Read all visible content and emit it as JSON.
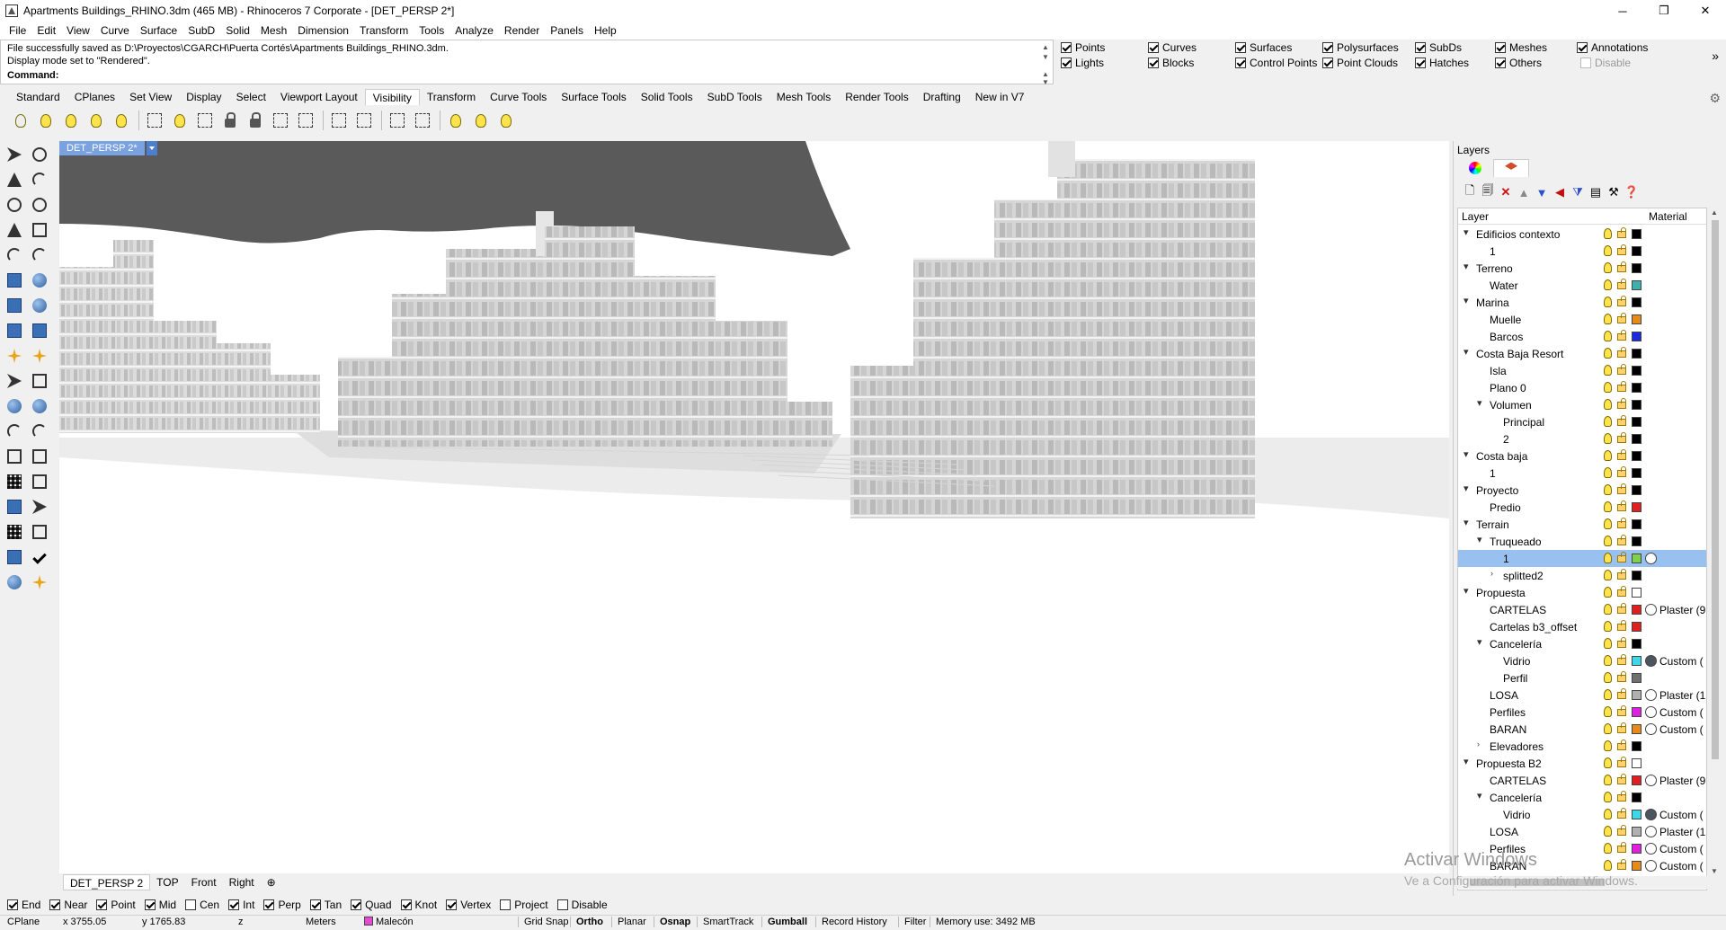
{
  "window": {
    "title": "Apartments Buildings_RHINO.3dm (465 MB) - Rhinoceros 7 Corporate - [DET_PERSP 2*]",
    "minimize": "─",
    "maximize": "❐",
    "close": "✕"
  },
  "menu": [
    "File",
    "Edit",
    "View",
    "Curve",
    "Surface",
    "SubD",
    "Solid",
    "Mesh",
    "Dimension",
    "Transform",
    "Tools",
    "Analyze",
    "Render",
    "Panels",
    "Help"
  ],
  "command": {
    "history_1": "File successfully saved as D:\\Proyectos\\CGARCH\\Puerta Cortés\\Apartments Buildings_RHINO.3dm.",
    "history_2": "Display mode set to \"Rendered\".",
    "prompt_label": "Command:",
    "input_value": ""
  },
  "selection_filters": [
    {
      "label": "Points",
      "checked": true
    },
    {
      "label": "Curves",
      "checked": true
    },
    {
      "label": "Surfaces",
      "checked": true
    },
    {
      "label": "Polysurfaces",
      "checked": true
    },
    {
      "label": "SubDs",
      "checked": true
    },
    {
      "label": "Meshes",
      "checked": true
    },
    {
      "label": "Annotations",
      "checked": true
    },
    {
      "label": "Lights",
      "checked": true
    },
    {
      "label": "Blocks",
      "checked": true
    },
    {
      "label": "Control Points",
      "checked": true
    },
    {
      "label": "Point Clouds",
      "checked": true
    },
    {
      "label": "Hatches",
      "checked": true
    },
    {
      "label": "Others",
      "checked": true
    },
    {
      "label": "Disable",
      "checked": false
    }
  ],
  "filters_more": "»",
  "toolbar_tabs": [
    "Standard",
    "CPlanes",
    "Set View",
    "Display",
    "Select",
    "Viewport Layout",
    "Visibility",
    "Transform",
    "Curve Tools",
    "Surface Tools",
    "Solid Tools",
    "SubD Tools",
    "Mesh Tools",
    "Render Tools",
    "Drafting",
    "New in V7"
  ],
  "active_toolbar_tab": "Visibility",
  "viewport": {
    "title": "DET_PERSP 2*"
  },
  "view_tabs": [
    "DET_PERSP 2",
    "TOP",
    "Front",
    "Right"
  ],
  "view_tabs_add": "⊕",
  "osnaps": [
    {
      "label": "End",
      "checked": true
    },
    {
      "label": "Near",
      "checked": true
    },
    {
      "label": "Point",
      "checked": true
    },
    {
      "label": "Mid",
      "checked": true
    },
    {
      "label": "Cen",
      "checked": false
    },
    {
      "label": "Int",
      "checked": true
    },
    {
      "label": "Perp",
      "checked": true
    },
    {
      "label": "Tan",
      "checked": true
    },
    {
      "label": "Quad",
      "checked": true
    },
    {
      "label": "Knot",
      "checked": true
    },
    {
      "label": "Vertex",
      "checked": true
    },
    {
      "label": "Project",
      "checked": false
    },
    {
      "label": "Disable",
      "checked": false
    }
  ],
  "status": {
    "cplane": "CPlane",
    "x": "x 3755.05",
    "y": "y 1765.83",
    "z": "z",
    "units": "Meters",
    "layer": "Malecón",
    "layer_color": "#e64bd6",
    "grid_snap": "Grid Snap",
    "ortho": "Ortho",
    "planar": "Planar",
    "osnap": "Osnap",
    "smarttrack": "SmartTrack",
    "gumball": "Gumball",
    "record_history": "Record History",
    "filter": "Filter",
    "memory": "Memory use: 3492 MB"
  },
  "layers_panel": {
    "title": "Layers",
    "col_layer": "Layer",
    "col_material": "Material",
    "rows": [
      {
        "name": "Edificios contexto",
        "indent": 0,
        "twisty": "open",
        "color": "#000000"
      },
      {
        "name": "1",
        "indent": 1,
        "twisty": "",
        "color": "#000000"
      },
      {
        "name": "Terreno",
        "indent": 0,
        "twisty": "open",
        "color": "#000000"
      },
      {
        "name": "Water",
        "indent": 1,
        "twisty": "",
        "color": "#3fb0b0"
      },
      {
        "name": "Marina",
        "indent": 0,
        "twisty": "open",
        "color": "#000000"
      },
      {
        "name": "Muelle",
        "indent": 1,
        "twisty": "",
        "color": "#e88a1a"
      },
      {
        "name": "Barcos",
        "indent": 1,
        "twisty": "",
        "color": "#1a28e0"
      },
      {
        "name": "Costa Baja Resort",
        "indent": 0,
        "twisty": "open",
        "color": "#000000"
      },
      {
        "name": "Isla",
        "indent": 1,
        "twisty": "",
        "color": "#000000"
      },
      {
        "name": "Plano 0",
        "indent": 1,
        "twisty": "",
        "color": "#000000"
      },
      {
        "name": "Volumen",
        "indent": 1,
        "twisty": "open",
        "color": "#000000"
      },
      {
        "name": "Principal",
        "indent": 2,
        "twisty": "",
        "color": "#000000"
      },
      {
        "name": "2",
        "indent": 2,
        "twisty": "",
        "color": "#000000"
      },
      {
        "name": "Costa baja",
        "indent": 0,
        "twisty": "open",
        "color": "#000000"
      },
      {
        "name": "1",
        "indent": 1,
        "twisty": "",
        "color": "#000000"
      },
      {
        "name": "Proyecto",
        "indent": 0,
        "twisty": "open",
        "color": "#000000"
      },
      {
        "name": "Predio",
        "indent": 1,
        "twisty": "",
        "color": "#e02020"
      },
      {
        "name": "Terrain",
        "indent": 0,
        "twisty": "open",
        "color": "#000000"
      },
      {
        "name": "Truqueado",
        "indent": 1,
        "twisty": "open",
        "color": "#000000"
      },
      {
        "name": "1",
        "indent": 2,
        "twisty": "",
        "color": "#7fd04a",
        "selected": true,
        "material_icon": true
      },
      {
        "name": "splitted2",
        "indent": 2,
        "twisty": "closed",
        "color": "#000000"
      },
      {
        "name": "Propuesta",
        "indent": 0,
        "twisty": "open",
        "color": "#ffffff"
      },
      {
        "name": "CARTELAS",
        "indent": 1,
        "twisty": "",
        "color": "#e02020",
        "material": "Plaster (9",
        "material_icon": true
      },
      {
        "name": "Cartelas b3_offset",
        "indent": 1,
        "twisty": "",
        "color": "#e02020"
      },
      {
        "name": "Cancelería",
        "indent": 1,
        "twisty": "open",
        "color": "#000000"
      },
      {
        "name": "Vidrio",
        "indent": 2,
        "twisty": "",
        "color": "#3ad8e8",
        "material": "Custom (",
        "material_icon": true,
        "material_dark": true
      },
      {
        "name": "Perfil",
        "indent": 2,
        "twisty": "",
        "color": "#707070"
      },
      {
        "name": "LOSA",
        "indent": 1,
        "twisty": "",
        "color": "#b0b0b0",
        "material": "Plaster (1",
        "material_icon": true
      },
      {
        "name": "Perfiles",
        "indent": 1,
        "twisty": "",
        "color": "#e020e0",
        "material": "Custom (",
        "material_icon": true
      },
      {
        "name": "BARAN",
        "indent": 1,
        "twisty": "",
        "color": "#e88a1a",
        "material": "Custom (",
        "material_icon": true
      },
      {
        "name": "Elevadores",
        "indent": 1,
        "twisty": "closed",
        "color": "#000000"
      },
      {
        "name": "Propuesta B2",
        "indent": 0,
        "twisty": "open",
        "color": "#ffffff"
      },
      {
        "name": "CARTELAS",
        "indent": 1,
        "twisty": "",
        "color": "#e02020",
        "material": "Plaster (9",
        "material_icon": true
      },
      {
        "name": "Cancelería",
        "indent": 1,
        "twisty": "open",
        "color": "#000000"
      },
      {
        "name": "Vidrio",
        "indent": 2,
        "twisty": "",
        "color": "#3ad8e8",
        "material": "Custom (",
        "material_icon": true,
        "material_dark": true
      },
      {
        "name": "LOSA",
        "indent": 1,
        "twisty": "",
        "color": "#b0b0b0",
        "material": "Plaster (1",
        "material_icon": true
      },
      {
        "name": "Perfiles",
        "indent": 1,
        "twisty": "",
        "color": "#e020e0",
        "material": "Custom (",
        "material_icon": true
      },
      {
        "name": "BARAN",
        "indent": 1,
        "twisty": "",
        "color": "#e88a1a",
        "material": "Custom (",
        "material_icon": true
      }
    ]
  },
  "watermark": {
    "line1": "Activar Windows",
    "line2": "Ve a Configuración para activar Windows."
  }
}
